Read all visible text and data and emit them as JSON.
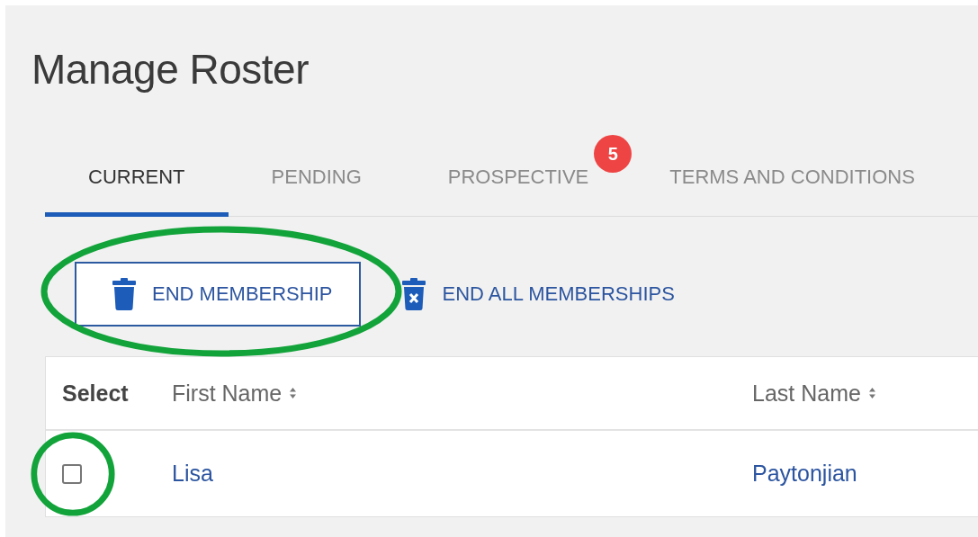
{
  "page_title": "Manage Roster",
  "tabs": [
    {
      "label": "CURRENT",
      "selected": true
    },
    {
      "label": "PENDING",
      "selected": false
    },
    {
      "label": "PROSPECTIVE",
      "selected": false,
      "badge": "5"
    },
    {
      "label": "TERMS AND CONDITIONS",
      "selected": false
    }
  ],
  "actions": [
    {
      "label": "END MEMBERSHIP",
      "kind": "outlined",
      "highlighted": true
    },
    {
      "label": "END ALL MEMBERSHIPS",
      "kind": "link",
      "highlighted": false
    }
  ],
  "table": {
    "columns": [
      {
        "label": "Select",
        "sortable": false
      },
      {
        "label": "First Name",
        "sortable": true
      },
      {
        "label": "Last Name",
        "sortable": true
      }
    ],
    "rows": [
      {
        "checked": false,
        "highlighted": true,
        "first_name": "Lisa",
        "last_name": "Paytonjian"
      }
    ]
  }
}
